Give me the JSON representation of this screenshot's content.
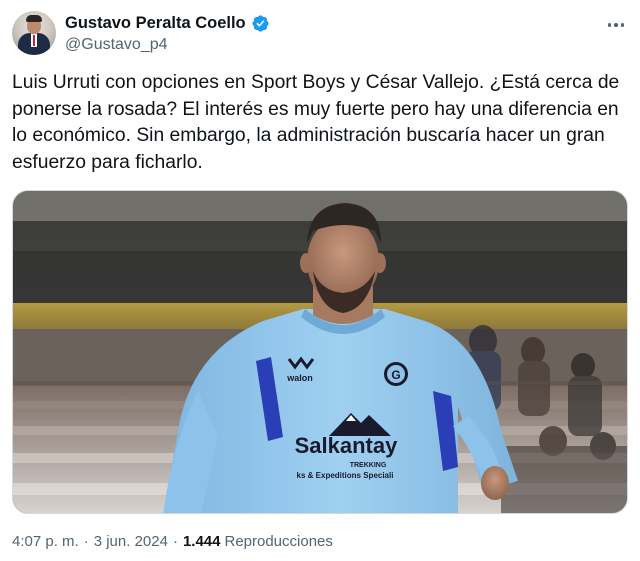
{
  "author": {
    "display_name": "Gustavo Peralta Coello",
    "handle": "@Gustavo_p4",
    "verified": true,
    "verified_color": "#1d9bf0"
  },
  "tweet": {
    "text": "Luis Urruti con opciones en Sport Boys y César Vallejo. ¿Está cerca de ponerse la rosada? El interés es muy fuerte pero hay una diferencia en lo económico. Sin embargo, la administración buscaría hacer un gran esfuerzo para ficharlo."
  },
  "media": {
    "jersey_sponsor": "Salkantay",
    "jersey_sponsor_sub1": "TREKKING",
    "jersey_sponsor_sub2": "ks & Expeditions Speciali",
    "jersey_brand": "walon",
    "jersey_crest": "G"
  },
  "meta": {
    "time": "4:07 p. m.",
    "separator": "·",
    "date": "3 jun. 2024",
    "views_count": "1.444",
    "views_label": "Reproducciones"
  },
  "icons": {
    "verified": "verified-badge-icon",
    "more": "more-options-icon"
  },
  "colors": {
    "text_primary": "#0f1419",
    "text_secondary": "#536471",
    "jersey": "#8fc3e8"
  }
}
